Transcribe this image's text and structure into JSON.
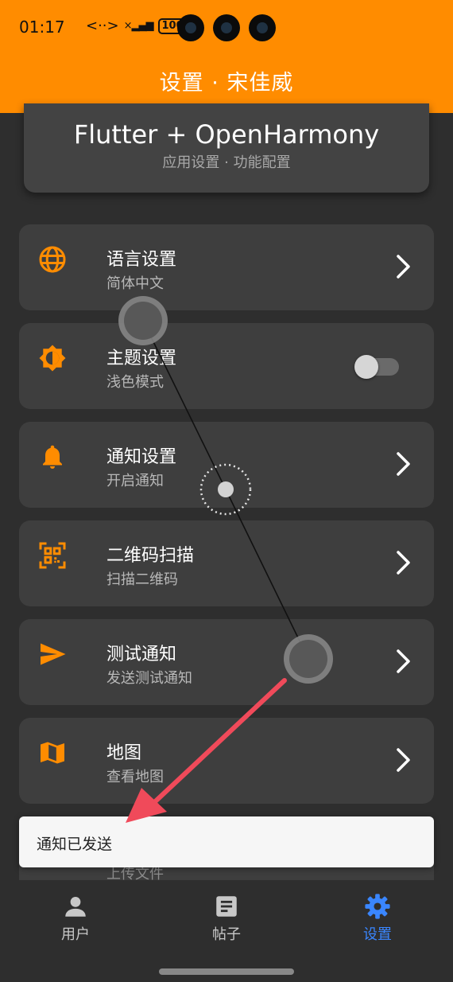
{
  "status_bar": {
    "time": "01:17",
    "link_glyph": "<··>",
    "signal_glyph": "×▂▄▆",
    "battery": "100"
  },
  "header": {
    "title": "设置 · 宋佳威"
  },
  "info_card": {
    "title": "Flutter + OpenHarmony",
    "subtitle": "应用设置 · 功能配置"
  },
  "settings": [
    {
      "title": "语言设置",
      "subtitle": "简体中文",
      "icon": "globe-icon",
      "control": "chevron"
    },
    {
      "title": "主题设置",
      "subtitle": "浅色模式",
      "icon": "brightness-icon",
      "control": "toggle",
      "toggle_on": false
    },
    {
      "title": "通知设置",
      "subtitle": "开启通知",
      "icon": "bell-icon",
      "control": "chevron"
    },
    {
      "title": "二维码扫描",
      "subtitle": "扫描二维码",
      "icon": "qr-scan-icon",
      "control": "chevron"
    },
    {
      "title": "测试通知",
      "subtitle": "发送测试通知",
      "icon": "send-icon",
      "control": "chevron"
    },
    {
      "title": "地图",
      "subtitle": "查看地图",
      "icon": "map-icon",
      "control": "chevron"
    },
    {
      "title": "",
      "subtitle": "上传文件",
      "icon": "",
      "control": "chevron"
    }
  ],
  "snackbar": {
    "message": "通知已发送"
  },
  "bottom_nav": [
    {
      "label": "用户",
      "icon": "person-icon",
      "active": false
    },
    {
      "label": "帖子",
      "icon": "article-icon",
      "active": false
    },
    {
      "label": "设置",
      "icon": "gear-icon",
      "active": true
    }
  ],
  "colors": {
    "accent": "#ff8c00",
    "background": "#2e2e2e",
    "card": "#3e3e3e",
    "nav_active": "#3a86ff",
    "annotation_arrow": "#f04a5a"
  }
}
